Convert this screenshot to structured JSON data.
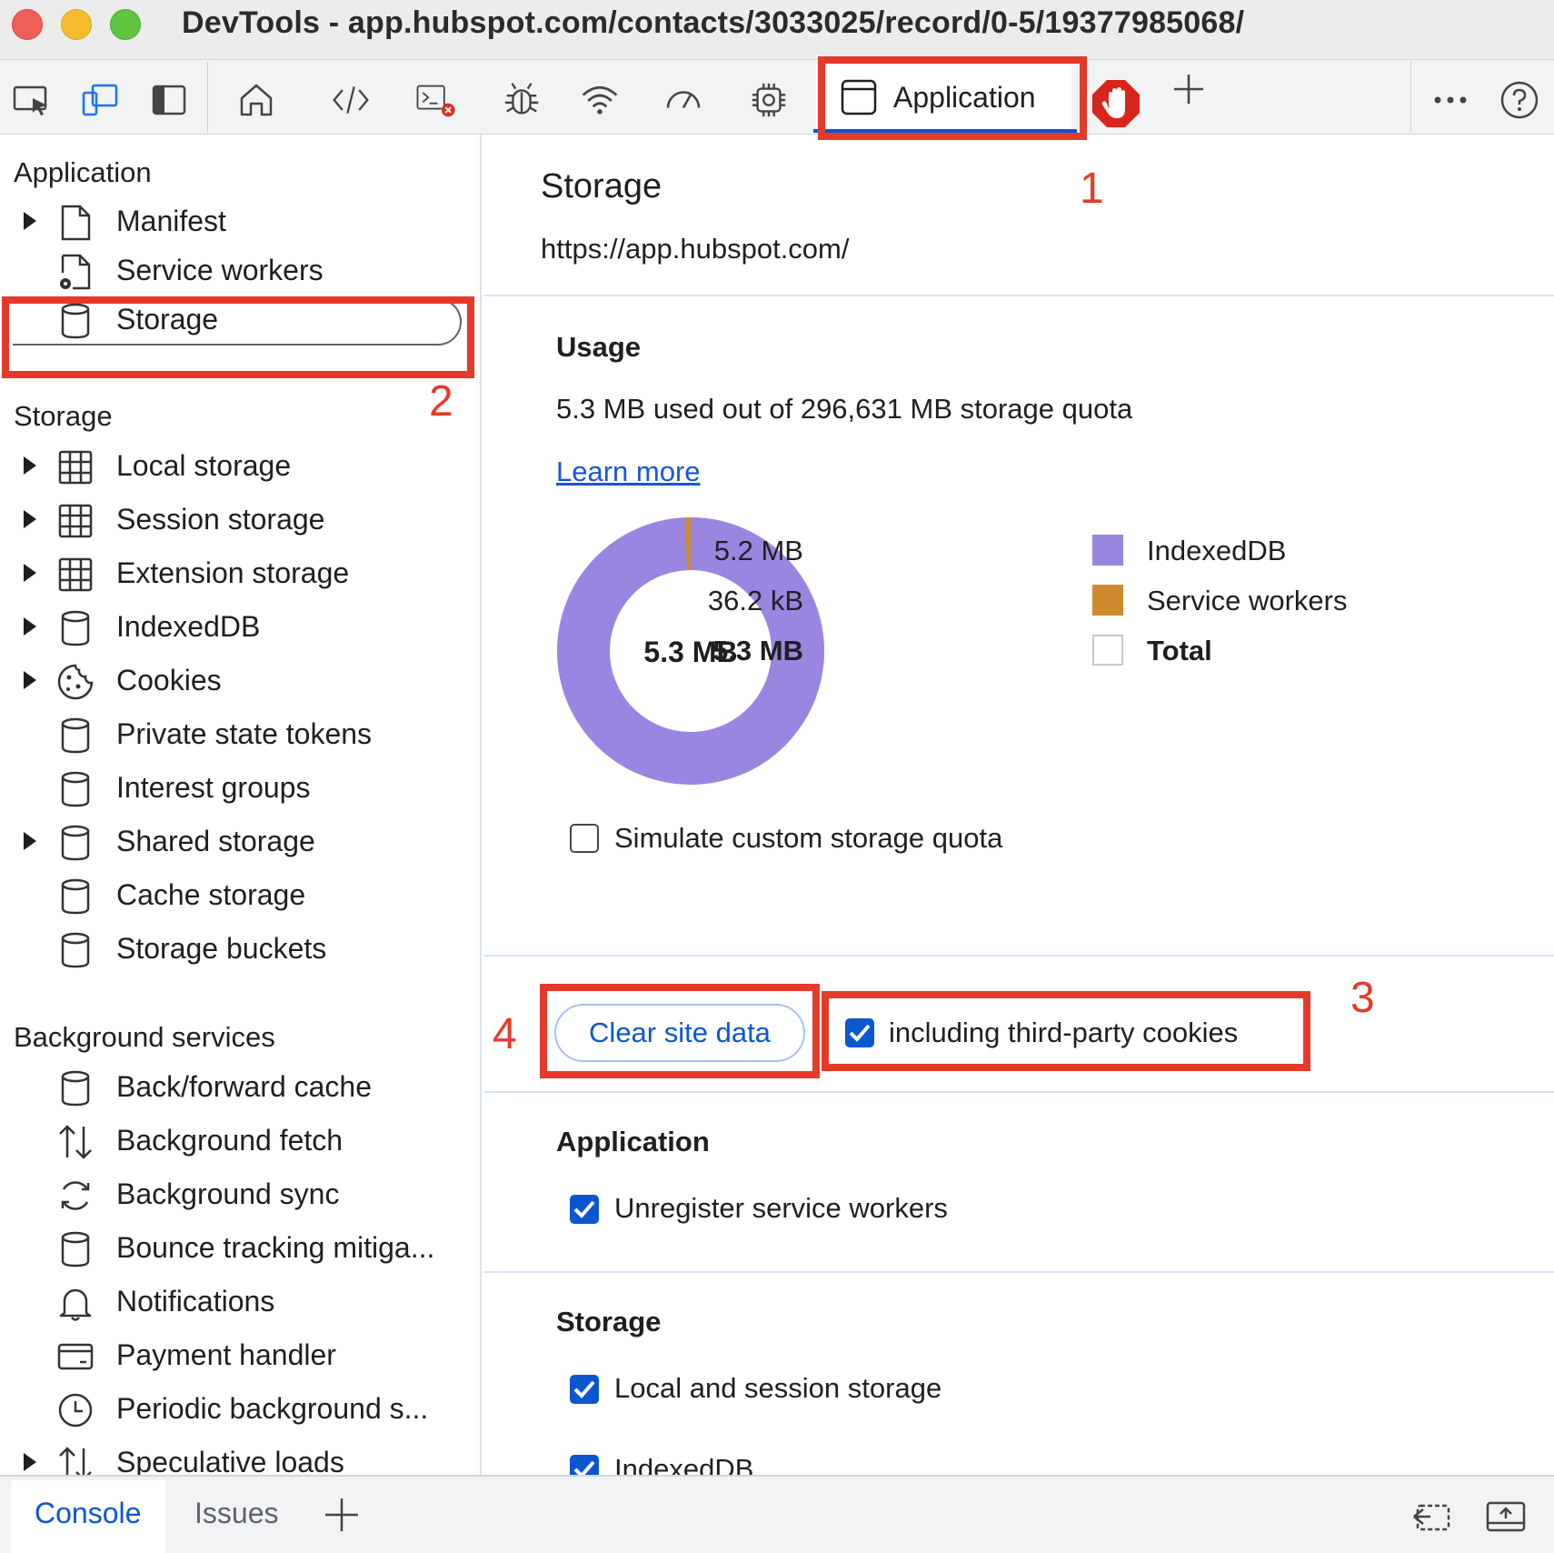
{
  "window": {
    "title": "DevTools - app.hubspot.com/contacts/3033025/record/0-5/19377985068/"
  },
  "toolbar": {
    "active_tab": "Application",
    "icons": [
      "inspect-element-icon",
      "device-toolbar-icon",
      "dock-side-icon",
      "home-icon",
      "elements-code-icon",
      "console-icon",
      "sources-bug-icon",
      "network-wifi-icon",
      "performance-gauge-icon",
      "memory-chip-icon",
      "application-window-icon",
      "stop-hand-icon",
      "add-tab-icon",
      "more-options-icon",
      "help-icon"
    ]
  },
  "sidebar": {
    "application_title": "Application",
    "application_items": [
      {
        "label": "Manifest",
        "expandable": true,
        "icon": "file-icon"
      },
      {
        "label": "Service workers",
        "expandable": false,
        "icon": "file-gear-icon"
      },
      {
        "label": "Storage",
        "expandable": false,
        "icon": "database-icon",
        "selected": true
      }
    ],
    "storage_title": "Storage",
    "storage_items": [
      {
        "label": "Local storage",
        "expandable": true,
        "icon": "grid-icon"
      },
      {
        "label": "Session storage",
        "expandable": true,
        "icon": "grid-icon"
      },
      {
        "label": "Extension storage",
        "expandable": true,
        "icon": "grid-icon"
      },
      {
        "label": "IndexedDB",
        "expandable": true,
        "icon": "database-icon"
      },
      {
        "label": "Cookies",
        "expandable": true,
        "icon": "cookie-icon"
      },
      {
        "label": "Private state tokens",
        "expandable": false,
        "icon": "database-icon"
      },
      {
        "label": "Interest groups",
        "expandable": false,
        "icon": "database-icon"
      },
      {
        "label": "Shared storage",
        "expandable": true,
        "icon": "database-icon"
      },
      {
        "label": "Cache storage",
        "expandable": false,
        "icon": "database-icon"
      },
      {
        "label": "Storage buckets",
        "expandable": false,
        "icon": "database-icon"
      }
    ],
    "background_title": "Background services",
    "background_items": [
      {
        "label": "Back/forward cache",
        "icon": "database-icon"
      },
      {
        "label": "Background fetch",
        "icon": "up-down-arrows-icon"
      },
      {
        "label": "Background sync",
        "icon": "sync-icon"
      },
      {
        "label": "Bounce tracking mitiga...",
        "icon": "database-icon"
      },
      {
        "label": "Notifications",
        "icon": "bell-icon"
      },
      {
        "label": "Payment handler",
        "icon": "card-icon"
      },
      {
        "label": "Periodic background s...",
        "icon": "clock-icon"
      },
      {
        "label": "Speculative loads",
        "icon": "up-down-arrows-icon",
        "expandable": true
      }
    ]
  },
  "main": {
    "title": "Storage",
    "origin": "https://app.hubspot.com/",
    "usage": {
      "heading": "Usage",
      "summary": "5.3 MB used out of 296,631 MB storage quota",
      "learn_more": "Learn more",
      "donut_center": "5.3 MB",
      "legend": [
        {
          "value": "5.2 MB",
          "name": "IndexedDB",
          "color": "#9a86e0",
          "fraction": 0.9932
        },
        {
          "value": "36.2 kB",
          "name": "Service workers",
          "color": "#cf8a2e",
          "fraction": 0.0068
        },
        {
          "value": "5.3 MB",
          "name": "Total",
          "color": "#ffffff",
          "bold": true
        }
      ],
      "simulate_quota_label": "Simulate custom storage quota",
      "simulate_quota_checked": false
    },
    "clear": {
      "button_label": "Clear site data",
      "third_party_label": "including third-party cookies",
      "third_party_checked": true
    },
    "application_section": {
      "heading": "Application",
      "items": [
        {
          "label": "Unregister service workers",
          "checked": true
        }
      ]
    },
    "storage_section": {
      "heading": "Storage",
      "items": [
        {
          "label": "Local and session storage",
          "checked": true
        },
        {
          "label": "IndexedDB",
          "checked": true
        }
      ]
    }
  },
  "annotations": [
    "1",
    "2",
    "3",
    "4"
  ],
  "drawer": {
    "tabs": [
      "Console",
      "Issues"
    ],
    "active": "Console"
  },
  "colors": {
    "accent": "#0b57d0",
    "annotation": "#e53a2a",
    "indexeddb": "#9a86e0",
    "service_workers": "#cf8a2e"
  }
}
